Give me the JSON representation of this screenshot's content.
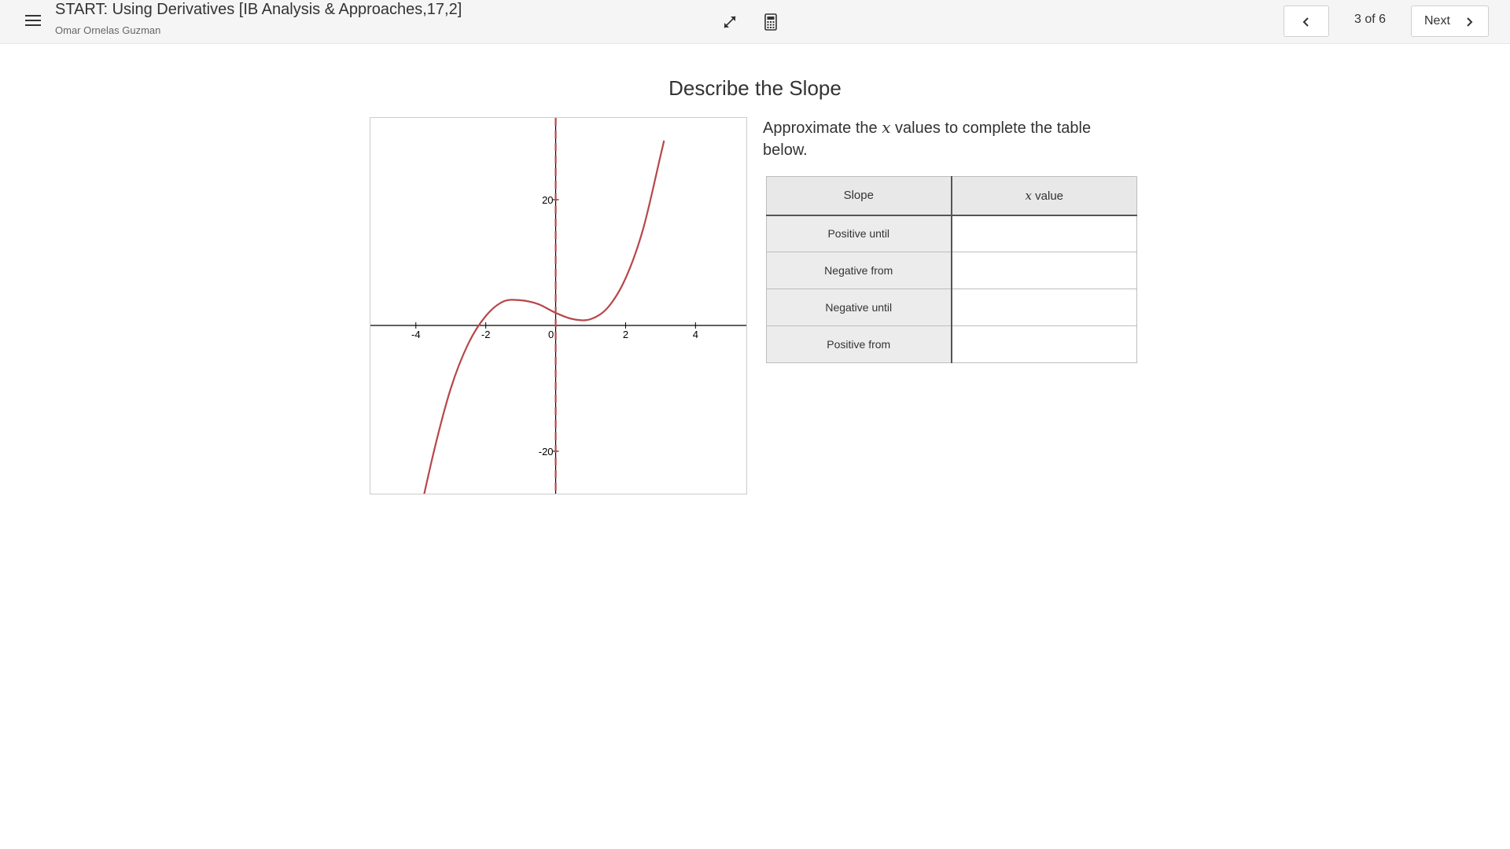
{
  "header": {
    "title": "START: Using Derivatives [IB Analysis & Approaches,17,2]",
    "author": "Omar Ornelas Guzman",
    "page_indicator": "3 of 6",
    "next_label": "Next",
    "icons": [
      "menu-icon",
      "expand-icon",
      "calculator-icon",
      "chevron-left-icon",
      "chevron-right-icon"
    ]
  },
  "activity": {
    "heading": "Describe the Slope",
    "prompt_before": "Approximate the ",
    "prompt_var": "x",
    "prompt_after": " values to complete the table below."
  },
  "table": {
    "headers": [
      "Slope",
      "value"
    ],
    "header_var": "x",
    "rows": [
      {
        "label": "Positive until",
        "value": ""
      },
      {
        "label": "Negative from",
        "value": ""
      },
      {
        "label": "Negative until",
        "value": ""
      },
      {
        "label": "Positive from",
        "value": ""
      }
    ]
  },
  "chart_data": {
    "type": "line",
    "function_samples": {
      "x": [
        -4.1,
        -3.5,
        -3.0,
        -2.5,
        -2.0,
        -1.5,
        -1.0,
        -0.5,
        0.0,
        0.5,
        1.0,
        1.5,
        2.0,
        2.5,
        3.0,
        3.1
      ],
      "y": [
        -35.4,
        -20.4,
        -10.0,
        -2.9,
        1.5,
        3.8,
        4.0,
        3.4,
        2.0,
        1.0,
        1.0,
        2.9,
        7.5,
        15.3,
        27.0,
        29.4
      ]
    },
    "x_ticks": [
      "-4",
      "-2",
      "0",
      "2",
      "4"
    ],
    "x_tick_values": [
      -4,
      -2,
      0,
      2,
      4
    ],
    "y_ticks": [
      "20",
      "-20"
    ],
    "y_tick_values": [
      20,
      -20
    ],
    "xlim": [
      -5.3,
      5.5
    ],
    "ylim": [
      -27,
      33
    ],
    "vertical_marker_x": 0,
    "colors": {
      "curve": "#b7474a",
      "marker": "#b7474a",
      "axis": "#000000"
    },
    "grid": false
  }
}
